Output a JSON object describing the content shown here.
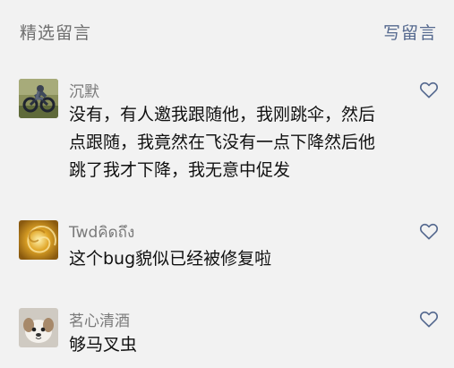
{
  "header": {
    "title": "精选留言",
    "write_label": "写留言"
  },
  "colors": {
    "background": "#f2f2f2",
    "link": "#55698f",
    "username": "#7a7a7a",
    "text": "#111111"
  },
  "comments": [
    {
      "username": "沉默",
      "lines": [
        "没有，有人邀我跟随他，我刚跳伞，然后",
        "点跟随，我竟然在飞没有一点下降然后他",
        "跳了我才下降，我无意中促发"
      ],
      "avatar_icon": "motorcycle-avatar",
      "like_icon": "heart-outline-icon"
    },
    {
      "username": "Twdคิดถึง",
      "lines": [
        "这个bug貌似已经被修复啦"
      ],
      "avatar_icon": "golden-swirl-avatar",
      "like_icon": "heart-outline-icon"
    },
    {
      "username": "茗心清酒",
      "lines": [
        "够马叉虫"
      ],
      "avatar_icon": "puppy-avatar",
      "like_icon": "heart-outline-icon"
    }
  ]
}
